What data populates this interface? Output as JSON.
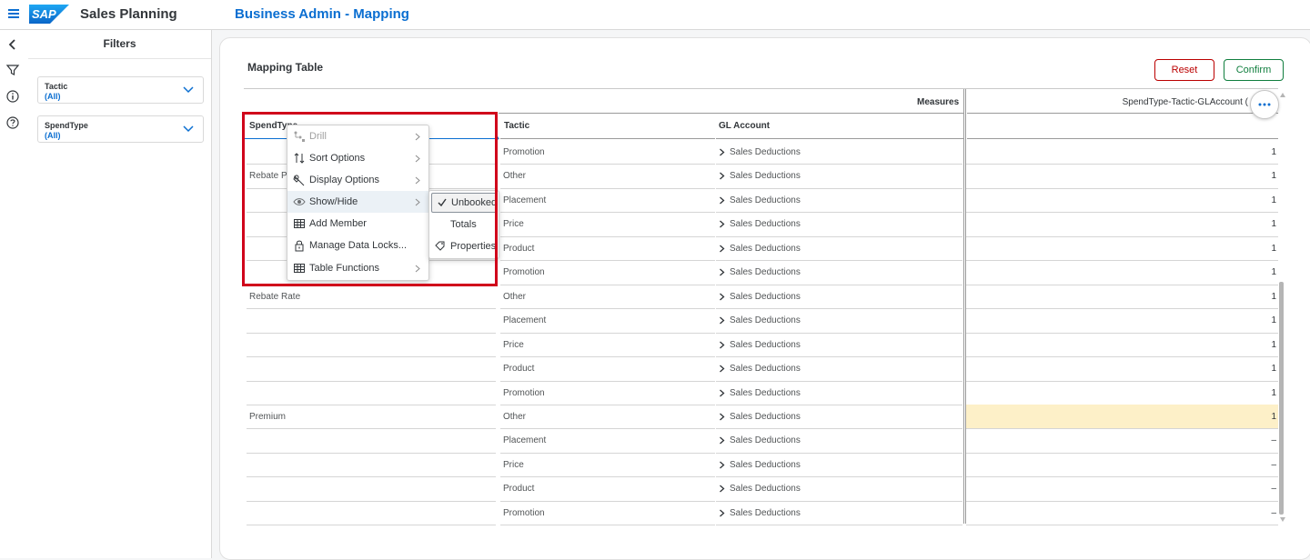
{
  "shell": {
    "app_title": "Sales Planning",
    "page_title": "Business Admin - Mapping"
  },
  "filters": {
    "title": "Filters",
    "items": [
      {
        "name": "Tactic",
        "value": "(All)"
      },
      {
        "name": "SpendType",
        "value": "(All)"
      }
    ]
  },
  "card": {
    "title": "Mapping Table",
    "reset_label": "Reset",
    "confirm_label": "Confirm"
  },
  "table": {
    "measures_label": "Measures",
    "measure_column": "SpendType-Tactic-GLAccount (",
    "columns": [
      "SpendType",
      "Tactic",
      "GL Account"
    ],
    "spendtype_rows": [
      {
        "row": 1,
        "label": "Rebate Pe"
      },
      {
        "row": 6,
        "label": "Rebate Rate"
      },
      {
        "row": 11,
        "label": "Premium"
      }
    ],
    "rows": [
      {
        "tactic": "Promotion",
        "gl": "Sales Deductions",
        "value": "1"
      },
      {
        "tactic": "Other",
        "gl": "Sales Deductions",
        "value": "1"
      },
      {
        "tactic": "Placement",
        "gl": "Sales Deductions",
        "value": "1"
      },
      {
        "tactic": "Price",
        "gl": "Sales Deductions",
        "value": "1"
      },
      {
        "tactic": "Product",
        "gl": "Sales Deductions",
        "value": "1"
      },
      {
        "tactic": "Promotion",
        "gl": "Sales Deductions",
        "value": "1"
      },
      {
        "tactic": "Other",
        "gl": "Sales Deductions",
        "value": "1"
      },
      {
        "tactic": "Placement",
        "gl": "Sales Deductions",
        "value": "1"
      },
      {
        "tactic": "Price",
        "gl": "Sales Deductions",
        "value": "1"
      },
      {
        "tactic": "Product",
        "gl": "Sales Deductions",
        "value": "1"
      },
      {
        "tactic": "Promotion",
        "gl": "Sales Deductions",
        "value": "1"
      },
      {
        "tactic": "Other",
        "gl": "Sales Deductions",
        "value": "1"
      },
      {
        "tactic": "Placement",
        "gl": "Sales Deductions",
        "value": "–"
      },
      {
        "tactic": "Price",
        "gl": "Sales Deductions",
        "value": "–"
      },
      {
        "tactic": "Product",
        "gl": "Sales Deductions",
        "value": "–"
      },
      {
        "tactic": "Promotion",
        "gl": "Sales Deductions",
        "value": "–"
      }
    ],
    "highlight_row": 11,
    "highlight_color": "#fdf0c8"
  },
  "context_menu": {
    "items": [
      {
        "label": "Drill",
        "icon": "drill-icon",
        "disabled": true,
        "submenu": true
      },
      {
        "label": "Sort Options",
        "icon": "sort-icon",
        "disabled": false,
        "submenu": true
      },
      {
        "label": "Display Options",
        "icon": "display-options-icon",
        "disabled": false,
        "submenu": true
      },
      {
        "label": "Show/Hide",
        "icon": "eye-icon",
        "disabled": false,
        "submenu": true,
        "hover": true
      },
      {
        "label": "Add Member",
        "icon": "add-member-icon",
        "disabled": false,
        "submenu": false
      },
      {
        "label": "Manage Data Locks...",
        "icon": "lock-icon",
        "disabled": false,
        "submenu": false
      },
      {
        "label": "Table Functions",
        "icon": "table-icon",
        "disabled": false,
        "submenu": true
      }
    ],
    "submenu": [
      {
        "label": "Unbooked",
        "checked": true,
        "icon": "checkmark-icon"
      },
      {
        "label": "Totals",
        "checked": false,
        "icon": ""
      },
      {
        "label": "Properties",
        "checked": false,
        "icon": "properties-icon"
      }
    ]
  },
  "colors": {
    "brand_blue": "#0a6ed1",
    "reset_red": "#bb0000",
    "confirm_green": "#107e3e",
    "annotation_red": "#d0021b"
  }
}
